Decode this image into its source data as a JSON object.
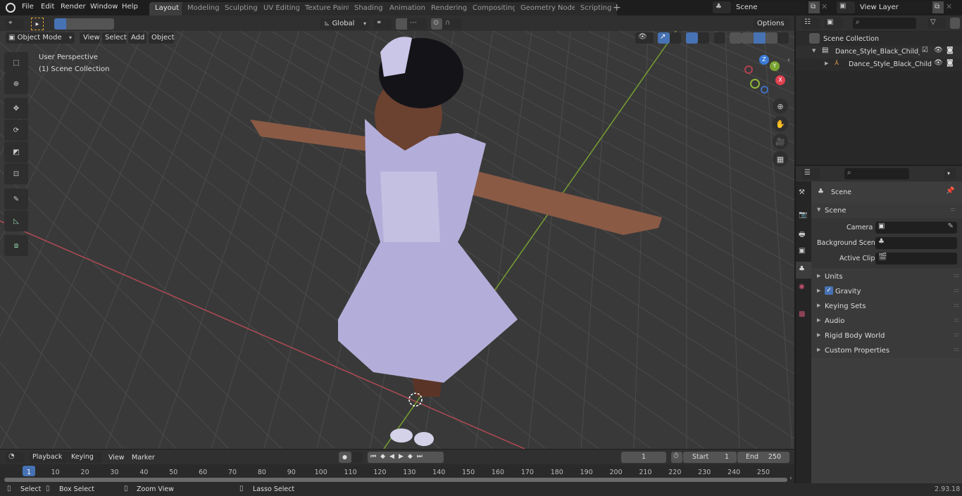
{
  "app": {
    "name": "Blender",
    "version": "2.93.18"
  },
  "menu": [
    "File",
    "Edit",
    "Render",
    "Window",
    "Help"
  ],
  "workspace_tabs": [
    {
      "label": "Layout",
      "active": true
    },
    {
      "label": "Modeling"
    },
    {
      "label": "Sculpting"
    },
    {
      "label": "UV Editing"
    },
    {
      "label": "Texture Paint"
    },
    {
      "label": "Shading"
    },
    {
      "label": "Animation"
    },
    {
      "label": "Rendering"
    },
    {
      "label": "Compositing"
    },
    {
      "label": "Geometry Nodes"
    },
    {
      "label": "Scripting"
    }
  ],
  "scene_selector": {
    "value": "Scene"
  },
  "view_layer_selector": {
    "value": "View Layer"
  },
  "viewport_header": {
    "mode": "Object Mode",
    "menus": [
      "View",
      "Select",
      "Add",
      "Object"
    ],
    "transform_orientation": "Global",
    "options_label": "Options"
  },
  "viewport": {
    "perspective_label": "User Perspective",
    "collection_label": "(1) Scene Collection",
    "gizmo_axes": [
      "X",
      "Y",
      "Z"
    ],
    "axis_colors": {
      "x": "#e0404f",
      "y": "#7aa32f",
      "z": "#3a7ad6"
    }
  },
  "toolbar_tools": [
    "select-box",
    "cursor",
    "move",
    "rotate",
    "scale",
    "transform",
    "annotate",
    "measure",
    "add-cube"
  ],
  "outliner": {
    "root": "Scene Collection",
    "items": [
      {
        "label": "Dance_Style_Black_Child_Girl",
        "type": "collection",
        "checked": true
      },
      {
        "label": "Dance_Style_Black_Child",
        "type": "armature"
      }
    ]
  },
  "properties": {
    "context_title": "Scene",
    "panel_title": "Scene",
    "fields": [
      {
        "label": "Camera",
        "value": ""
      },
      {
        "label": "Background Scene",
        "value": ""
      },
      {
        "label": "Active Clip",
        "value": ""
      }
    ],
    "subpanels": [
      {
        "label": "Units"
      },
      {
        "label": "Gravity",
        "checkbox": true,
        "checked": true
      },
      {
        "label": "Keying Sets"
      },
      {
        "label": "Audio"
      },
      {
        "label": "Rigid Body World"
      },
      {
        "label": "Custom Properties"
      }
    ]
  },
  "timeline": {
    "menus": [
      "Playback",
      "Keying",
      "View",
      "Marker"
    ],
    "current_frame": "1",
    "start_label": "Start",
    "start": "1",
    "end_label": "End",
    "end": "250",
    "ticks": [
      "1",
      "10",
      "20",
      "30",
      "40",
      "50",
      "60",
      "70",
      "80",
      "90",
      "100",
      "110",
      "120",
      "130",
      "140",
      "150",
      "160",
      "170",
      "180",
      "190",
      "200",
      "210",
      "220",
      "230",
      "240",
      "250"
    ]
  },
  "statusbar": {
    "hints": [
      "Select",
      "Box Select",
      "Zoom View",
      "Lasso Select"
    ],
    "version": "2.93.18"
  }
}
